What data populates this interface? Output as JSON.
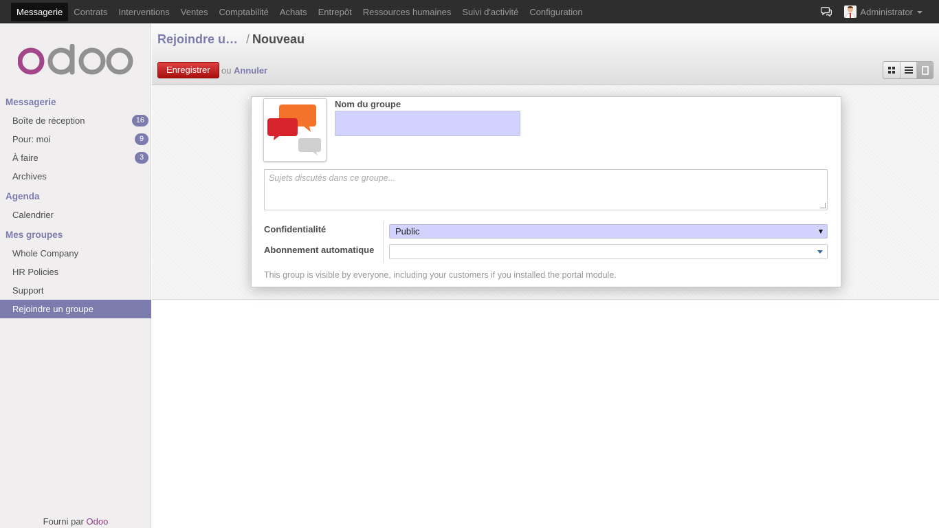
{
  "topbar": {
    "menu": [
      "Messagerie",
      "Contrats",
      "Interventions",
      "Ventes",
      "Comptabilité",
      "Achats",
      "Entrepôt",
      "Ressources humaines",
      "Suivi d'activité",
      "Configuration"
    ],
    "active_menu": "Messagerie",
    "user": "Administrator"
  },
  "sidebar": {
    "sections": [
      {
        "title": "Messagerie",
        "items": [
          {
            "label": "Boîte de réception",
            "badge": "16"
          },
          {
            "label": "Pour: moi",
            "badge": "9"
          },
          {
            "label": "À faire",
            "badge": "3"
          },
          {
            "label": "Archives"
          }
        ]
      },
      {
        "title": "Agenda",
        "items": [
          {
            "label": "Calendrier"
          }
        ]
      },
      {
        "title": "Mes groupes",
        "items": [
          {
            "label": "Whole Company"
          },
          {
            "label": "HR Policies"
          },
          {
            "label": "Support"
          },
          {
            "label": "Rejoindre un groupe",
            "active": true
          }
        ]
      }
    ],
    "footer_prefix": "Fourni par",
    "footer_brand": "Odoo"
  },
  "control_panel": {
    "breadcrumb_parent": "Rejoindre u…",
    "breadcrumb_separator": "/",
    "breadcrumb_current": "Nouveau",
    "save_label": "Enregistrer",
    "or_text": "ou",
    "cancel_label": "Annuler",
    "views": [
      "kanban",
      "list",
      "form"
    ],
    "active_view": "form"
  },
  "form": {
    "name_label": "Nom du groupe",
    "name_value": "",
    "description_placeholder": "Sujets discutés dans ce groupe...",
    "privacy_label": "Confidentialité",
    "privacy_value": "Public",
    "auto_follow_label": "Abonnement automatique",
    "auto_follow_value": "",
    "help_text": "This group is visible by everyone, including your customers if you installed the portal module."
  },
  "colors": {
    "topbar_bg": "#2e2e2e",
    "accent": "#7c7bad",
    "save_button": "#c32b2b",
    "required_field": "#d2d2ff",
    "brand": "#8f3a84"
  }
}
